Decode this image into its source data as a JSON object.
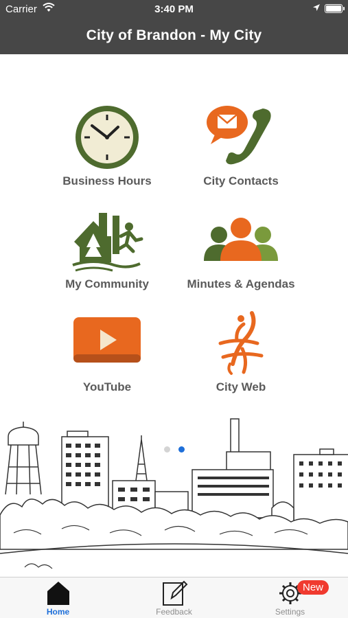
{
  "status_bar": {
    "carrier": "Carrier",
    "time": "3:40 PM"
  },
  "nav": {
    "title": "City of Brandon - My City"
  },
  "tiles": [
    {
      "label": "Business Hours",
      "icon": "clock-icon"
    },
    {
      "label": "City Contacts",
      "icon": "phone-email-icon"
    },
    {
      "label": "My Community",
      "icon": "community-icon"
    },
    {
      "label": "Minutes & Agendas",
      "icon": "people-group-icon"
    },
    {
      "label": "YouTube",
      "icon": "youtube-play-icon"
    },
    {
      "label": "City Web",
      "icon": "city-web-logo-icon"
    }
  ],
  "pager": {
    "count": 2,
    "active_index": 1
  },
  "tabbar": {
    "tabs": [
      {
        "label": "Home",
        "icon": "home-icon",
        "active": true
      },
      {
        "label": "Feedback",
        "icon": "feedback-icon",
        "active": false
      },
      {
        "label": "Settings",
        "icon": "gear-icon",
        "active": false
      }
    ],
    "settings_badge": "New"
  },
  "colors": {
    "nav_bg": "#474747",
    "accent_green": "#4e6b2e",
    "accent_orange": "#e8681f",
    "tab_active": "#1e6fd9",
    "badge": "#f03a2f"
  }
}
